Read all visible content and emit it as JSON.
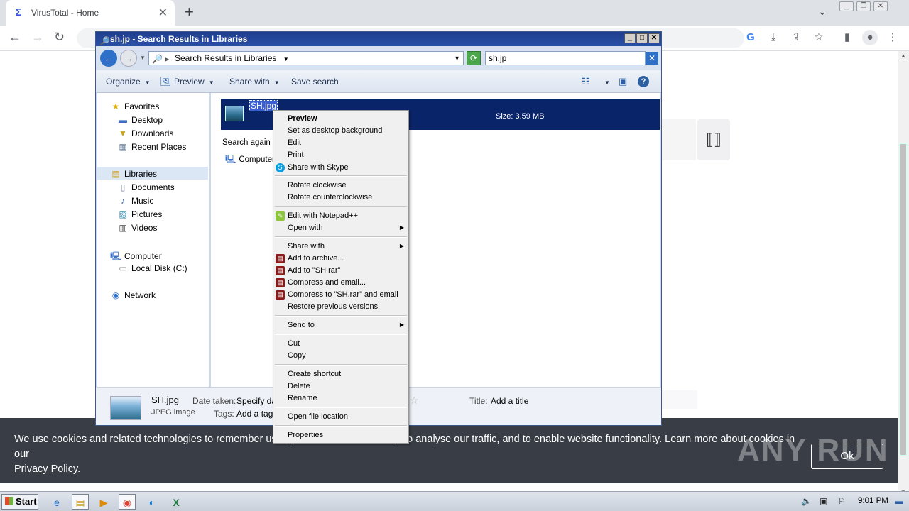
{
  "browser": {
    "tab_title": "VirusTotal - Home",
    "tab_close": "✕",
    "new_tab": "+",
    "tab_search": "⌄",
    "window_controls": [
      "_",
      "❐",
      "✕"
    ],
    "nav": {
      "back": "←",
      "forward": "→",
      "reload": "↻"
    },
    "toolbar_icons": [
      "google-icon",
      "download-icon",
      "share-icon",
      "bookmark-star-icon",
      "sidebar-icon",
      "profile-icon",
      "menu-icon"
    ]
  },
  "page": {
    "cookie_text": "We use cookies and related technologies to remember user preferences, for security, to analyse our traffic, and to enable website functionality. Learn more about cookies in our",
    "cookie_link": "Privacy Policy",
    "cookie_link_suffix": ".",
    "cookie_ok": "Ok",
    "watermark": "ANY RUN"
  },
  "explorer": {
    "title": "sh.jp - Search Results in Libraries",
    "address": "Search Results in Libraries",
    "search_value": "sh.jp",
    "commands": {
      "organize": "Organize",
      "preview": "Preview",
      "share_with": "Share with",
      "save_search": "Save search"
    },
    "nav": {
      "favorites": "Favorites",
      "desktop": "Desktop",
      "downloads": "Downloads",
      "recent_places": "Recent Places",
      "libraries": "Libraries",
      "documents": "Documents",
      "music": "Music",
      "pictures": "Pictures",
      "videos": "Videos",
      "computer": "Computer",
      "local_disk": "Local Disk (C:)",
      "network": "Network"
    },
    "result": {
      "name": "SH.jpg",
      "size": "Size: 3.59 MB"
    },
    "search_again": "Search again in:",
    "computer_option": "Computer",
    "details": {
      "name": "SH.jpg",
      "type": "JPEG image",
      "date_taken_label": "Date taken:",
      "date_taken_value": "Specify date taken",
      "tags_label": "Tags:",
      "tags_value": "Add a tag",
      "title_label": "Title:",
      "title_value": "Add a title"
    }
  },
  "context_menu": {
    "preview": "Preview",
    "set_bg": "Set as desktop background",
    "edit": "Edit",
    "print": "Print",
    "share_skype": "Share with Skype",
    "rotate_cw": "Rotate clockwise",
    "rotate_ccw": "Rotate counterclockwise",
    "edit_npp": "Edit with Notepad++",
    "open_with": "Open with",
    "share_with": "Share with",
    "add_archive": "Add to archive...",
    "add_rar": "Add to \"SH.rar\"",
    "compress_email": "Compress and email...",
    "compress_rar_email": "Compress to \"SH.rar\" and email",
    "restore_versions": "Restore previous versions",
    "send_to": "Send to",
    "cut": "Cut",
    "copy": "Copy",
    "create_shortcut": "Create shortcut",
    "delete": "Delete",
    "rename": "Rename",
    "open_location": "Open file location",
    "properties": "Properties"
  },
  "taskbar": {
    "start": "Start",
    "clock": "9:01 PM"
  }
}
